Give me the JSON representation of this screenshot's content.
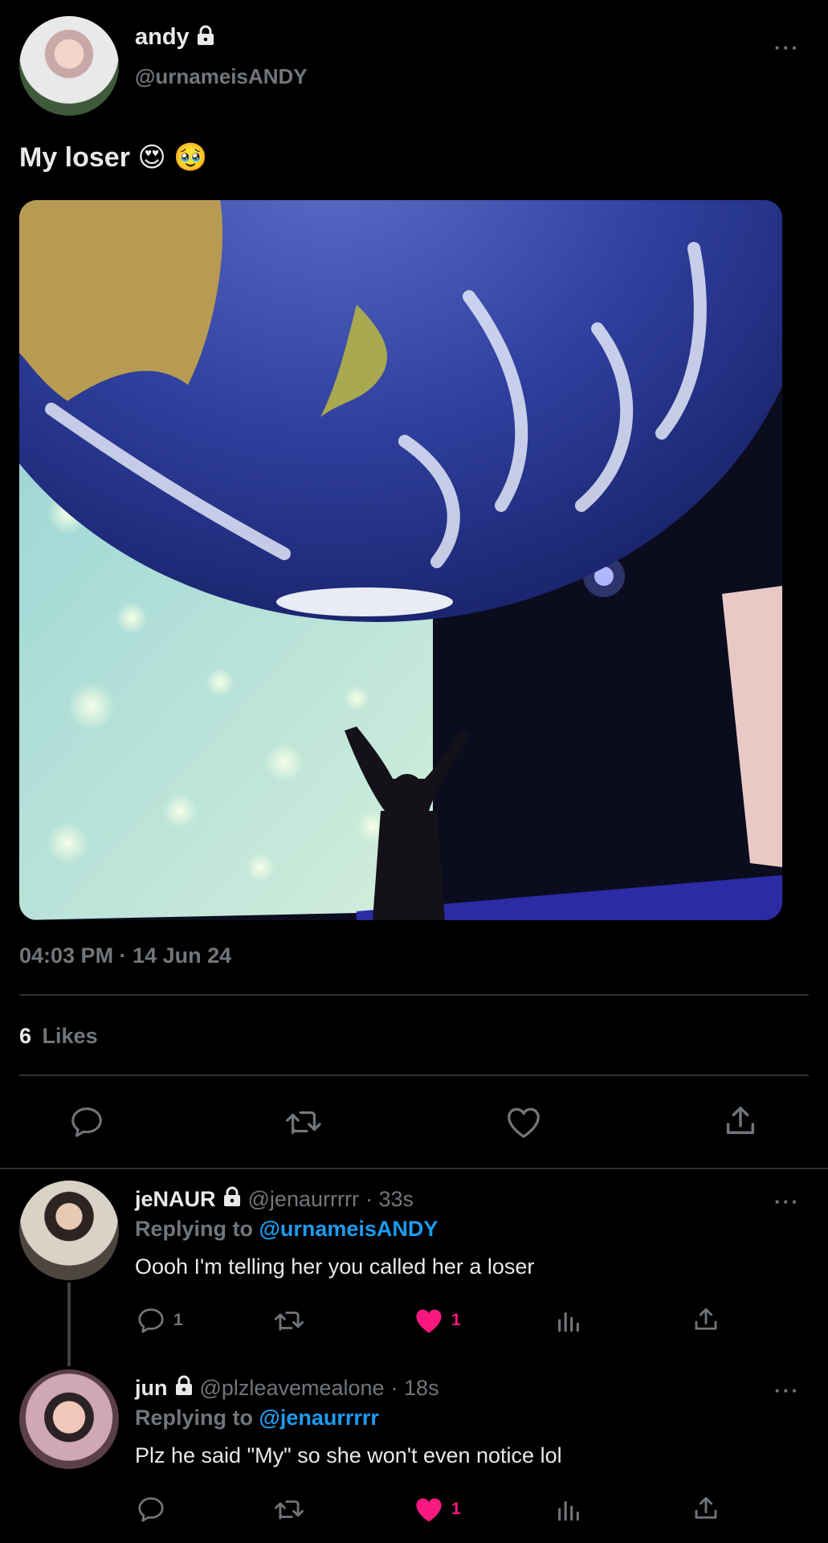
{
  "tweet": {
    "display_name": "andy",
    "handle": "@urnameisANDY",
    "text": "My loser 😍 🥹",
    "timestamp": "04:03 PM · 14 Jun 24",
    "likes_count": "6",
    "likes_label": "Likes",
    "more": "···"
  },
  "replies": [
    {
      "display_name": "jeNAUR",
      "handle": "@jenaurrrrr",
      "time": "· 33s",
      "replying_label": "Replying to",
      "replying_to": "@urnameisANDY",
      "text": "Oooh I'm telling her you called her a loser",
      "reply_count": "1",
      "like_count": "1",
      "more": "···"
    },
    {
      "display_name": "jun",
      "handle": "@plzleavemealone",
      "time": "· 18s",
      "replying_label": "Replying to",
      "replying_to": "@jenaurrrrr",
      "text": "Plz he said \"My\" so she won't even notice lol",
      "like_count": "1",
      "more": "···"
    }
  ],
  "colors": {
    "accent": "#1d9bf0",
    "like": "#f91880",
    "muted": "#71767b",
    "bg": "#000000"
  },
  "icons": [
    "lock-icon",
    "reply-icon",
    "retweet-icon",
    "like-icon",
    "share-icon",
    "analytics-icon",
    "more-icon"
  ]
}
